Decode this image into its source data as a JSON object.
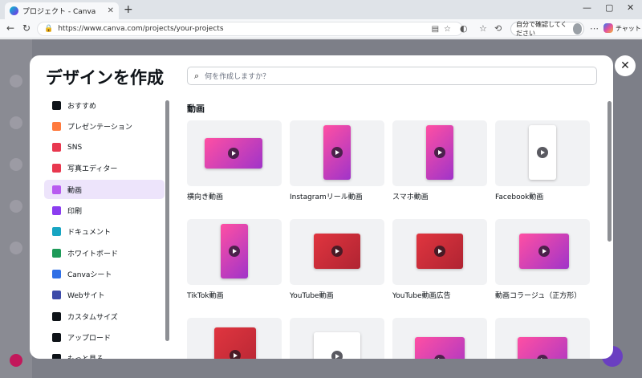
{
  "browser": {
    "tab_title": "プロジェクト - Canva",
    "url": "https://www.canva.com/projects/your-projects",
    "profile_label": "自分で確認してください",
    "copilot_label": "チャット"
  },
  "modal": {
    "title": "デザインを作成",
    "search_placeholder": "何を作成しますか？",
    "section_title": "動画",
    "sidebar": [
      {
        "label": "おすすめ",
        "color": "#0e1318"
      },
      {
        "label": "プレゼンテーション",
        "color": "#ff7a3d"
      },
      {
        "label": "SNS",
        "color": "#e8384f"
      },
      {
        "label": "写真エディター",
        "color": "#e8384f"
      },
      {
        "label": "動画",
        "color": "#b85cf0"
      },
      {
        "label": "印刷",
        "color": "#8b3df0"
      },
      {
        "label": "ドキュメント",
        "color": "#17a5c2"
      },
      {
        "label": "ホワイトボード",
        "color": "#1d9a58"
      },
      {
        "label": "Canvaシート",
        "color": "#2f6fe6"
      },
      {
        "label": "Webサイト",
        "color": "#3c4aa8"
      },
      {
        "label": "カスタムサイズ",
        "color": "#0e1318"
      },
      {
        "label": "アップロード",
        "color": "#0e1318"
      },
      {
        "label": "もっと見る",
        "color": "#0e1318"
      }
    ],
    "cards": [
      {
        "label": "横向き動画"
      },
      {
        "label": "Instagramリール動画"
      },
      {
        "label": "スマホ動画"
      },
      {
        "label": "Facebook動画"
      },
      {
        "label": "TikTok動画"
      },
      {
        "label": "YouTube動画"
      },
      {
        "label": "YouTube動画広告"
      },
      {
        "label": "動画コラージュ（正方形）"
      },
      {
        "label": ""
      },
      {
        "label": ""
      },
      {
        "label": ""
      },
      {
        "label": ""
      }
    ]
  }
}
